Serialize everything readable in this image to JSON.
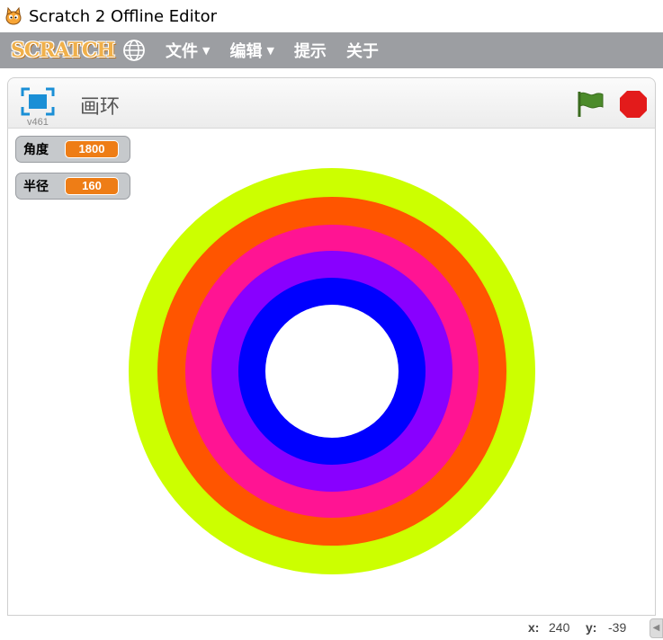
{
  "window": {
    "title": "Scratch 2 Offline Editor",
    "icon": "scratch-cat-icon"
  },
  "menubar": {
    "logo_text": "SCRATCH",
    "globe_icon": "globe-icon",
    "items": [
      {
        "label": "文件",
        "has_caret": true
      },
      {
        "label": "编辑",
        "has_caret": true
      },
      {
        "label": "提示",
        "has_caret": false
      },
      {
        "label": "关于",
        "has_caret": false
      }
    ],
    "caret": "▼"
  },
  "stage_header": {
    "version": "v461",
    "project_title": "画环"
  },
  "monitors": [
    {
      "label": "角度",
      "value": "1800"
    },
    {
      "label": "半径",
      "value": "160"
    }
  ],
  "stage_drawing": {
    "rings_outer_to_inner": [
      "#ccff00",
      "#ff5500",
      "#ff1493",
      "#8800ff",
      "#0000ff",
      "#ffffff"
    ]
  },
  "status": {
    "x_label": "x:",
    "x_value": "240",
    "y_label": "y:",
    "y_value": "-39",
    "scroll_arrow": "◀"
  },
  "colors": {
    "menubar_bg": "#9c9ea2",
    "monitor_value_bg": "#ee7d16",
    "stop_red": "#e31b1b",
    "flag_green": "#4c8b2b"
  }
}
